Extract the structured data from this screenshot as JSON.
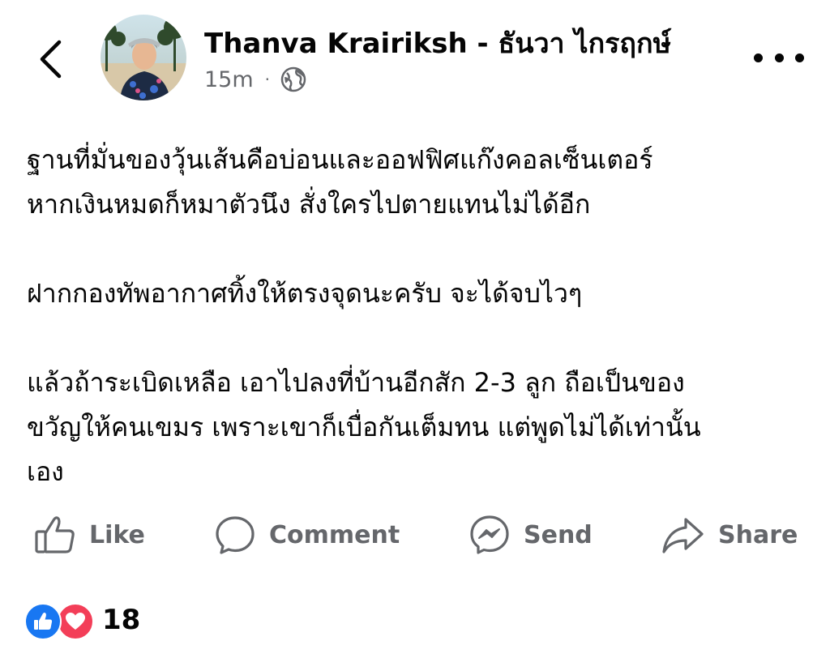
{
  "header": {
    "author_name": "Thanva Krairiksh - ธันวา ไกรฤกษ์",
    "timestamp": "15m",
    "separator": "·",
    "audience_icon": "globe-icon",
    "back_icon": "chevron-left-icon",
    "more_icon": "more-horizontal-icon"
  },
  "post": {
    "paragraphs": [
      [
        "ฐานที่มั่นของวุ้นเส้นคือบ่อนและออฟฟิศแก๊งคอลเซ็นเตอร์",
        "หากเงินหมดก็หมาตัวนึง สั่งใครไปตายแทนไม่ได้อีก"
      ],
      [
        "ฝากกองทัพอากาศทิ้งให้ตรงจุดนะครับ จะได้จบไวๆ"
      ],
      [
        "แล้วถ้าระเบิดเหลือ เอาไปลงที่บ้านอีกสัก 2-3 ลูก ถือเป็นของ",
        "ขวัญให้คนเขมร เพราะเขาก็เบื่อกันเต็มทน แต่พูดไม่ได้เท่านั้น",
        "เอง"
      ]
    ]
  },
  "actions": {
    "like": "Like",
    "comment": "Comment",
    "send": "Send",
    "share": "Share"
  },
  "reactions": {
    "count": "18",
    "types": [
      "like",
      "love"
    ]
  },
  "colors": {
    "text": "#050505",
    "secondary": "#65676b",
    "like_blue": "#1877f2",
    "love_red": "#f33e58"
  }
}
